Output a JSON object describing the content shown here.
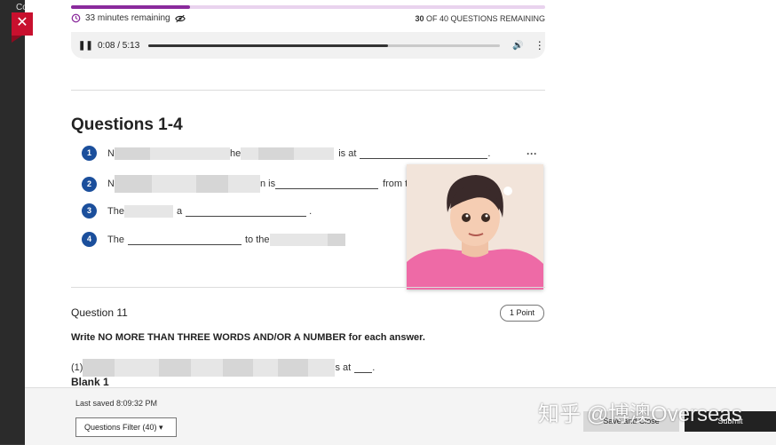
{
  "background": {
    "left_text": "Co"
  },
  "close_label": "✕",
  "progress": {
    "fraction": 0.25
  },
  "timer": {
    "text": "33 minutes remaining"
  },
  "remaining": {
    "count": "30",
    "text": "OF 40 QUESTIONS REMAINING"
  },
  "audio": {
    "time": "0:08 / 5:13",
    "played_fraction": 0.68
  },
  "questions": {
    "heading": "Questions 1-4",
    "items": [
      {
        "num": "1",
        "prefix": "N",
        "mid": "he",
        "suffix": "is at",
        "end": "."
      },
      {
        "num": "2",
        "prefix": "N",
        "mid": "n is",
        "suffix": "from the"
      },
      {
        "num": "3",
        "prefix": "The",
        "mid": "a",
        "end": "."
      },
      {
        "num": "4",
        "prefix": "The",
        "mid": "to the"
      }
    ]
  },
  "question11": {
    "label": "Question 11",
    "points": "1 Point",
    "instruction": "Write NO MORE THAN THREE WORDS AND/OR A NUMBER for each answer.",
    "answer_prefix": "(1)",
    "answer_mid": "s at",
    "answer_end": ".",
    "blank_label": "Blank 1"
  },
  "footer": {
    "last_saved": "Last saved 8:09:32 PM",
    "filter_label": "Questions Filter (40)",
    "save_close_label": "Save and Close",
    "submit_label": "Submit"
  },
  "watermark": "知乎 @博澳Overseas",
  "colors": {
    "accent": "#8a2a9c",
    "question_number": "#1b4f9c",
    "close": "#c8102e"
  }
}
